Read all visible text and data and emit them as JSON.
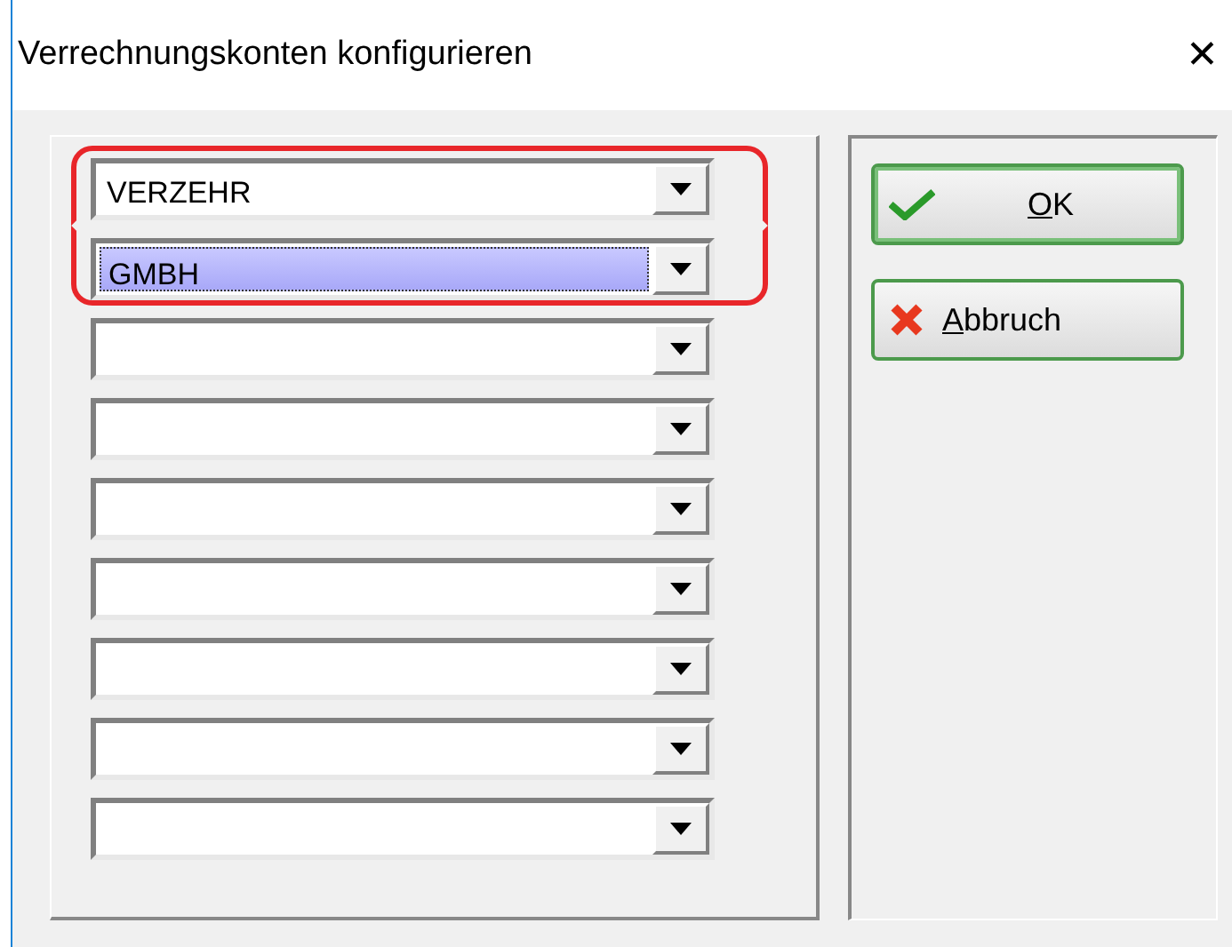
{
  "window": {
    "title": "Verrechnungskonten konfigurieren",
    "close": "✕"
  },
  "combos": [
    {
      "value": "VERZEHR",
      "selected": false,
      "highlighted": true
    },
    {
      "value": "GMBH",
      "selected": true,
      "highlighted": true
    },
    {
      "selected": false,
      "highlighted": false
    },
    {
      "selected": false,
      "highlighted": false
    },
    {
      "selected": false,
      "highlighted": false
    },
    {
      "selected": false,
      "highlighted": false
    },
    {
      "selected": false,
      "highlighted": false
    },
    {
      "selected": false,
      "highlighted": false
    },
    {
      "selected": false,
      "highlighted": false
    }
  ],
  "buttons": [
    {
      "label": "OK",
      "kind": "ok",
      "mnemonic_first": true,
      "default": true
    },
    {
      "label": "Abbruch",
      "kind": "cancel",
      "mnemonic_first": true,
      "default": false
    }
  ]
}
